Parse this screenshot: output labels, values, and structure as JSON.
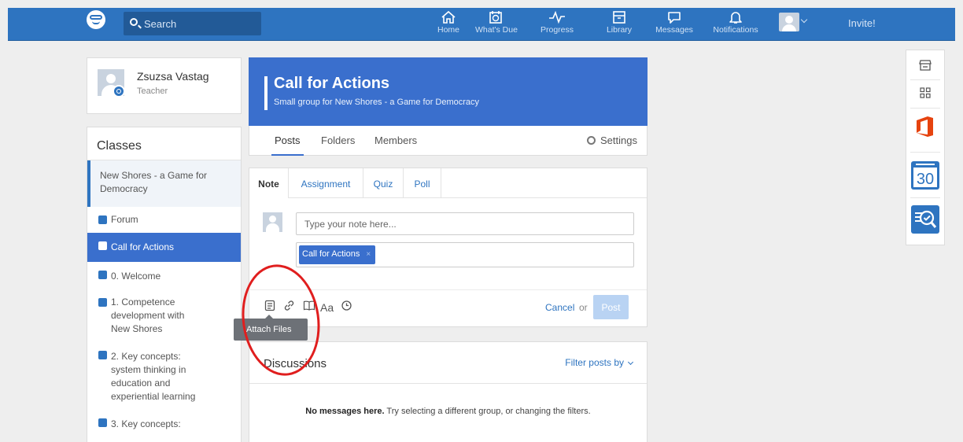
{
  "nav": {
    "search_placeholder": "Search",
    "items": [
      {
        "label": "Home",
        "icon": "home-icon"
      },
      {
        "label": "What's Due",
        "icon": "calendar-check-icon"
      },
      {
        "label": "Progress",
        "icon": "pulse-icon"
      },
      {
        "label": "Library",
        "icon": "library-icon"
      },
      {
        "label": "Messages",
        "icon": "speech-bubble-icon"
      },
      {
        "label": "Notifications",
        "icon": "bell-icon"
      }
    ],
    "invite": "Invite!"
  },
  "profile": {
    "name": "Zsuzsa Vastag",
    "role": "Teacher"
  },
  "classes": {
    "title": "Classes",
    "parent": "New Shores - a Game for Democracy",
    "items": [
      {
        "label": "Forum"
      },
      {
        "label": "Call for Actions",
        "active": true
      },
      {
        "label": "0. Welcome"
      },
      {
        "label": "1. Competence development with New Shores"
      },
      {
        "label": "2. Key concepts: system thinking in education and experiential learning"
      },
      {
        "label": "3. Key concepts:"
      }
    ]
  },
  "group": {
    "title": "Call for Actions",
    "subtitle": "Small group for New Shores - a Game for Democracy",
    "tabs": [
      "Posts",
      "Folders",
      "Members"
    ],
    "settings": "Settings"
  },
  "composer": {
    "tabs": [
      "Note",
      "Assignment",
      "Quiz",
      "Poll"
    ],
    "note_placeholder": "Type your note here...",
    "recipient_chip": "Call for Actions",
    "chip_remove": "×",
    "text_format": "Aa",
    "cancel": "Cancel",
    "or": "or",
    "post": "Post",
    "tooltip": "Attach Files"
  },
  "discussions": {
    "title": "Discussions",
    "filter": "Filter posts by",
    "empty_bold": "No messages here.",
    "empty_rest": " Try selecting a different group, or changing the filters."
  },
  "apps": [
    "store-icon",
    "apps-grid-icon",
    "office-icon",
    "calendar-30-icon",
    "search-check-icon"
  ],
  "colors": {
    "brand": "#2e74c0",
    "accent": "#3a6fcd",
    "annotation": "#e01e1e"
  }
}
